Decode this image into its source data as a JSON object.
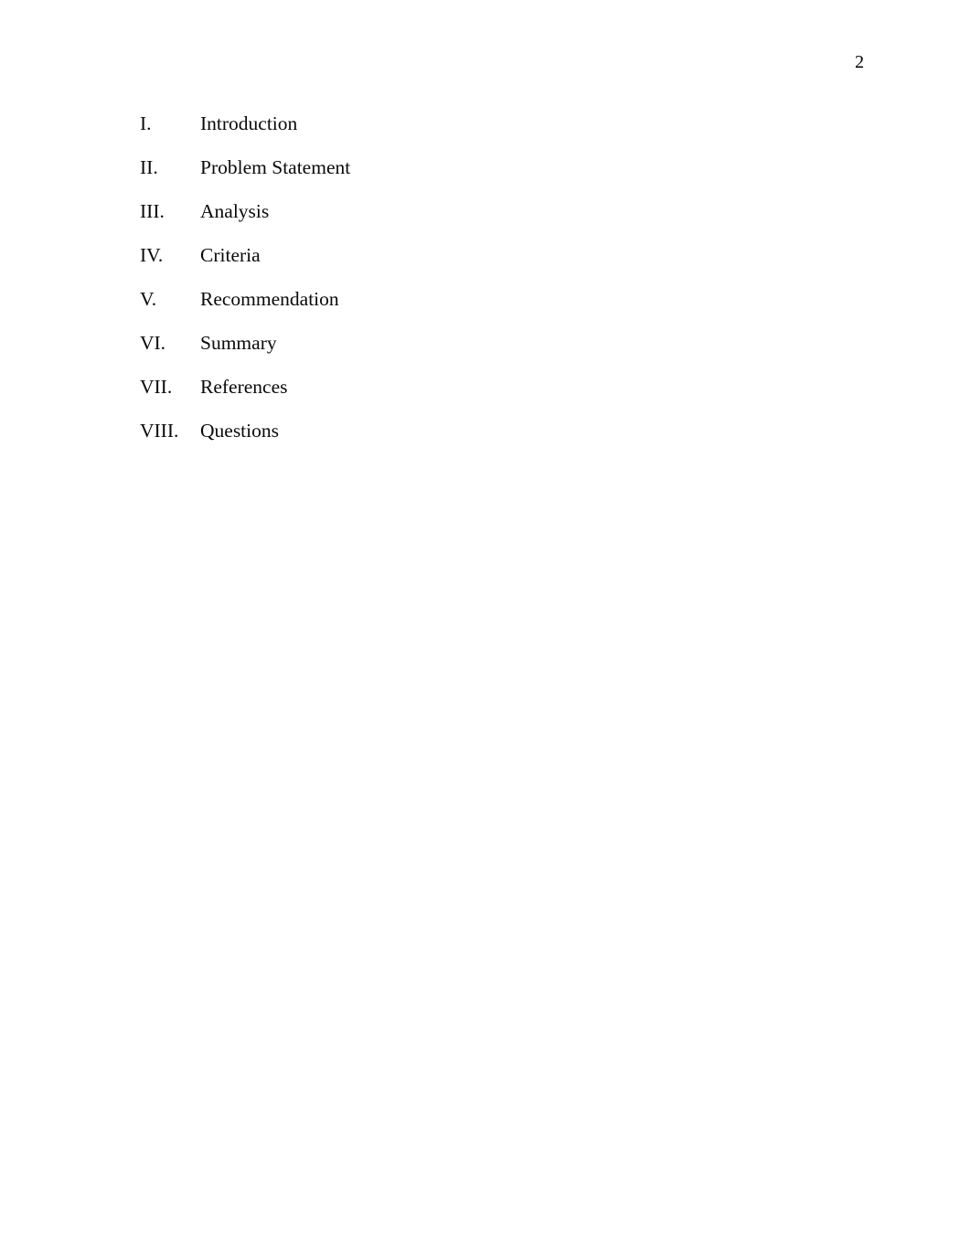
{
  "document": {
    "page_number": "2",
    "background_color": "#ffffff",
    "text_color": "#000000"
  },
  "outline": {
    "items": [
      {
        "numeral": "I.",
        "label": "Introduction"
      },
      {
        "numeral": "II.",
        "label": "Problem Statement"
      },
      {
        "numeral": "III.",
        "label": "Analysis"
      },
      {
        "numeral": "IV.",
        "label": "Criteria"
      },
      {
        "numeral": "V.",
        "label": "Recommendation"
      },
      {
        "numeral": "VI.",
        "label": "Summary"
      },
      {
        "numeral": "VII.",
        "label": "References"
      },
      {
        "numeral": "VIII.",
        "label": "Questions"
      }
    ]
  }
}
